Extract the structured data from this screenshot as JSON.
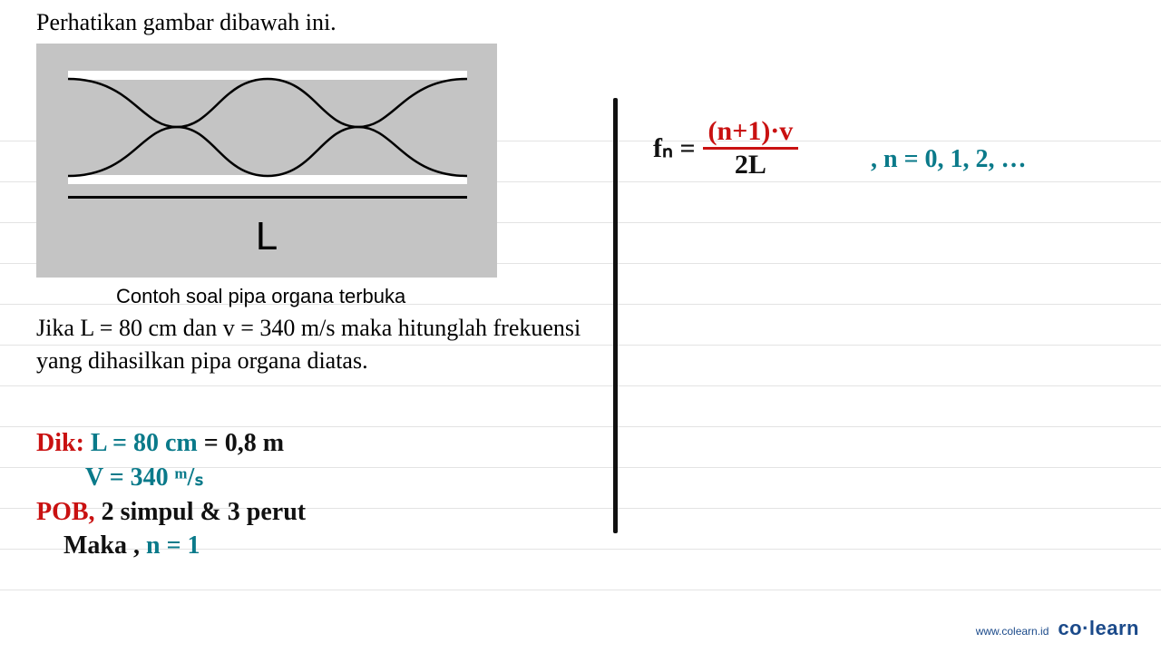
{
  "title": "Perhatikan gambar dibawah ini.",
  "diagram": {
    "length_label": "L"
  },
  "caption": "Contoh soal pipa organa terbuka",
  "problem": "Jika L = 80 cm dan v = 340 m/s maka hitunglah frekuensi yang dihasilkan pipa organa diatas.",
  "notes": {
    "dik_label": "Dik:",
    "L_given": "L = 80 cm",
    "L_conv": "= 0,8 m",
    "v_given": "V = 340 ᵐ/ₛ",
    "pob_label": "POB,",
    "pob_desc": "2 simpul & 3 perut",
    "maka": "Maka ,",
    "n_eq": "n = 1"
  },
  "formula": {
    "lhs": "fₙ =",
    "numerator": "(n+1)·v",
    "denominator": "2L",
    "n_values": ", n = 0, 1, 2, …"
  },
  "footer": {
    "url": "www.colearn.id",
    "brand_left": "co",
    "brand_dot": "·",
    "brand_right": "learn"
  }
}
